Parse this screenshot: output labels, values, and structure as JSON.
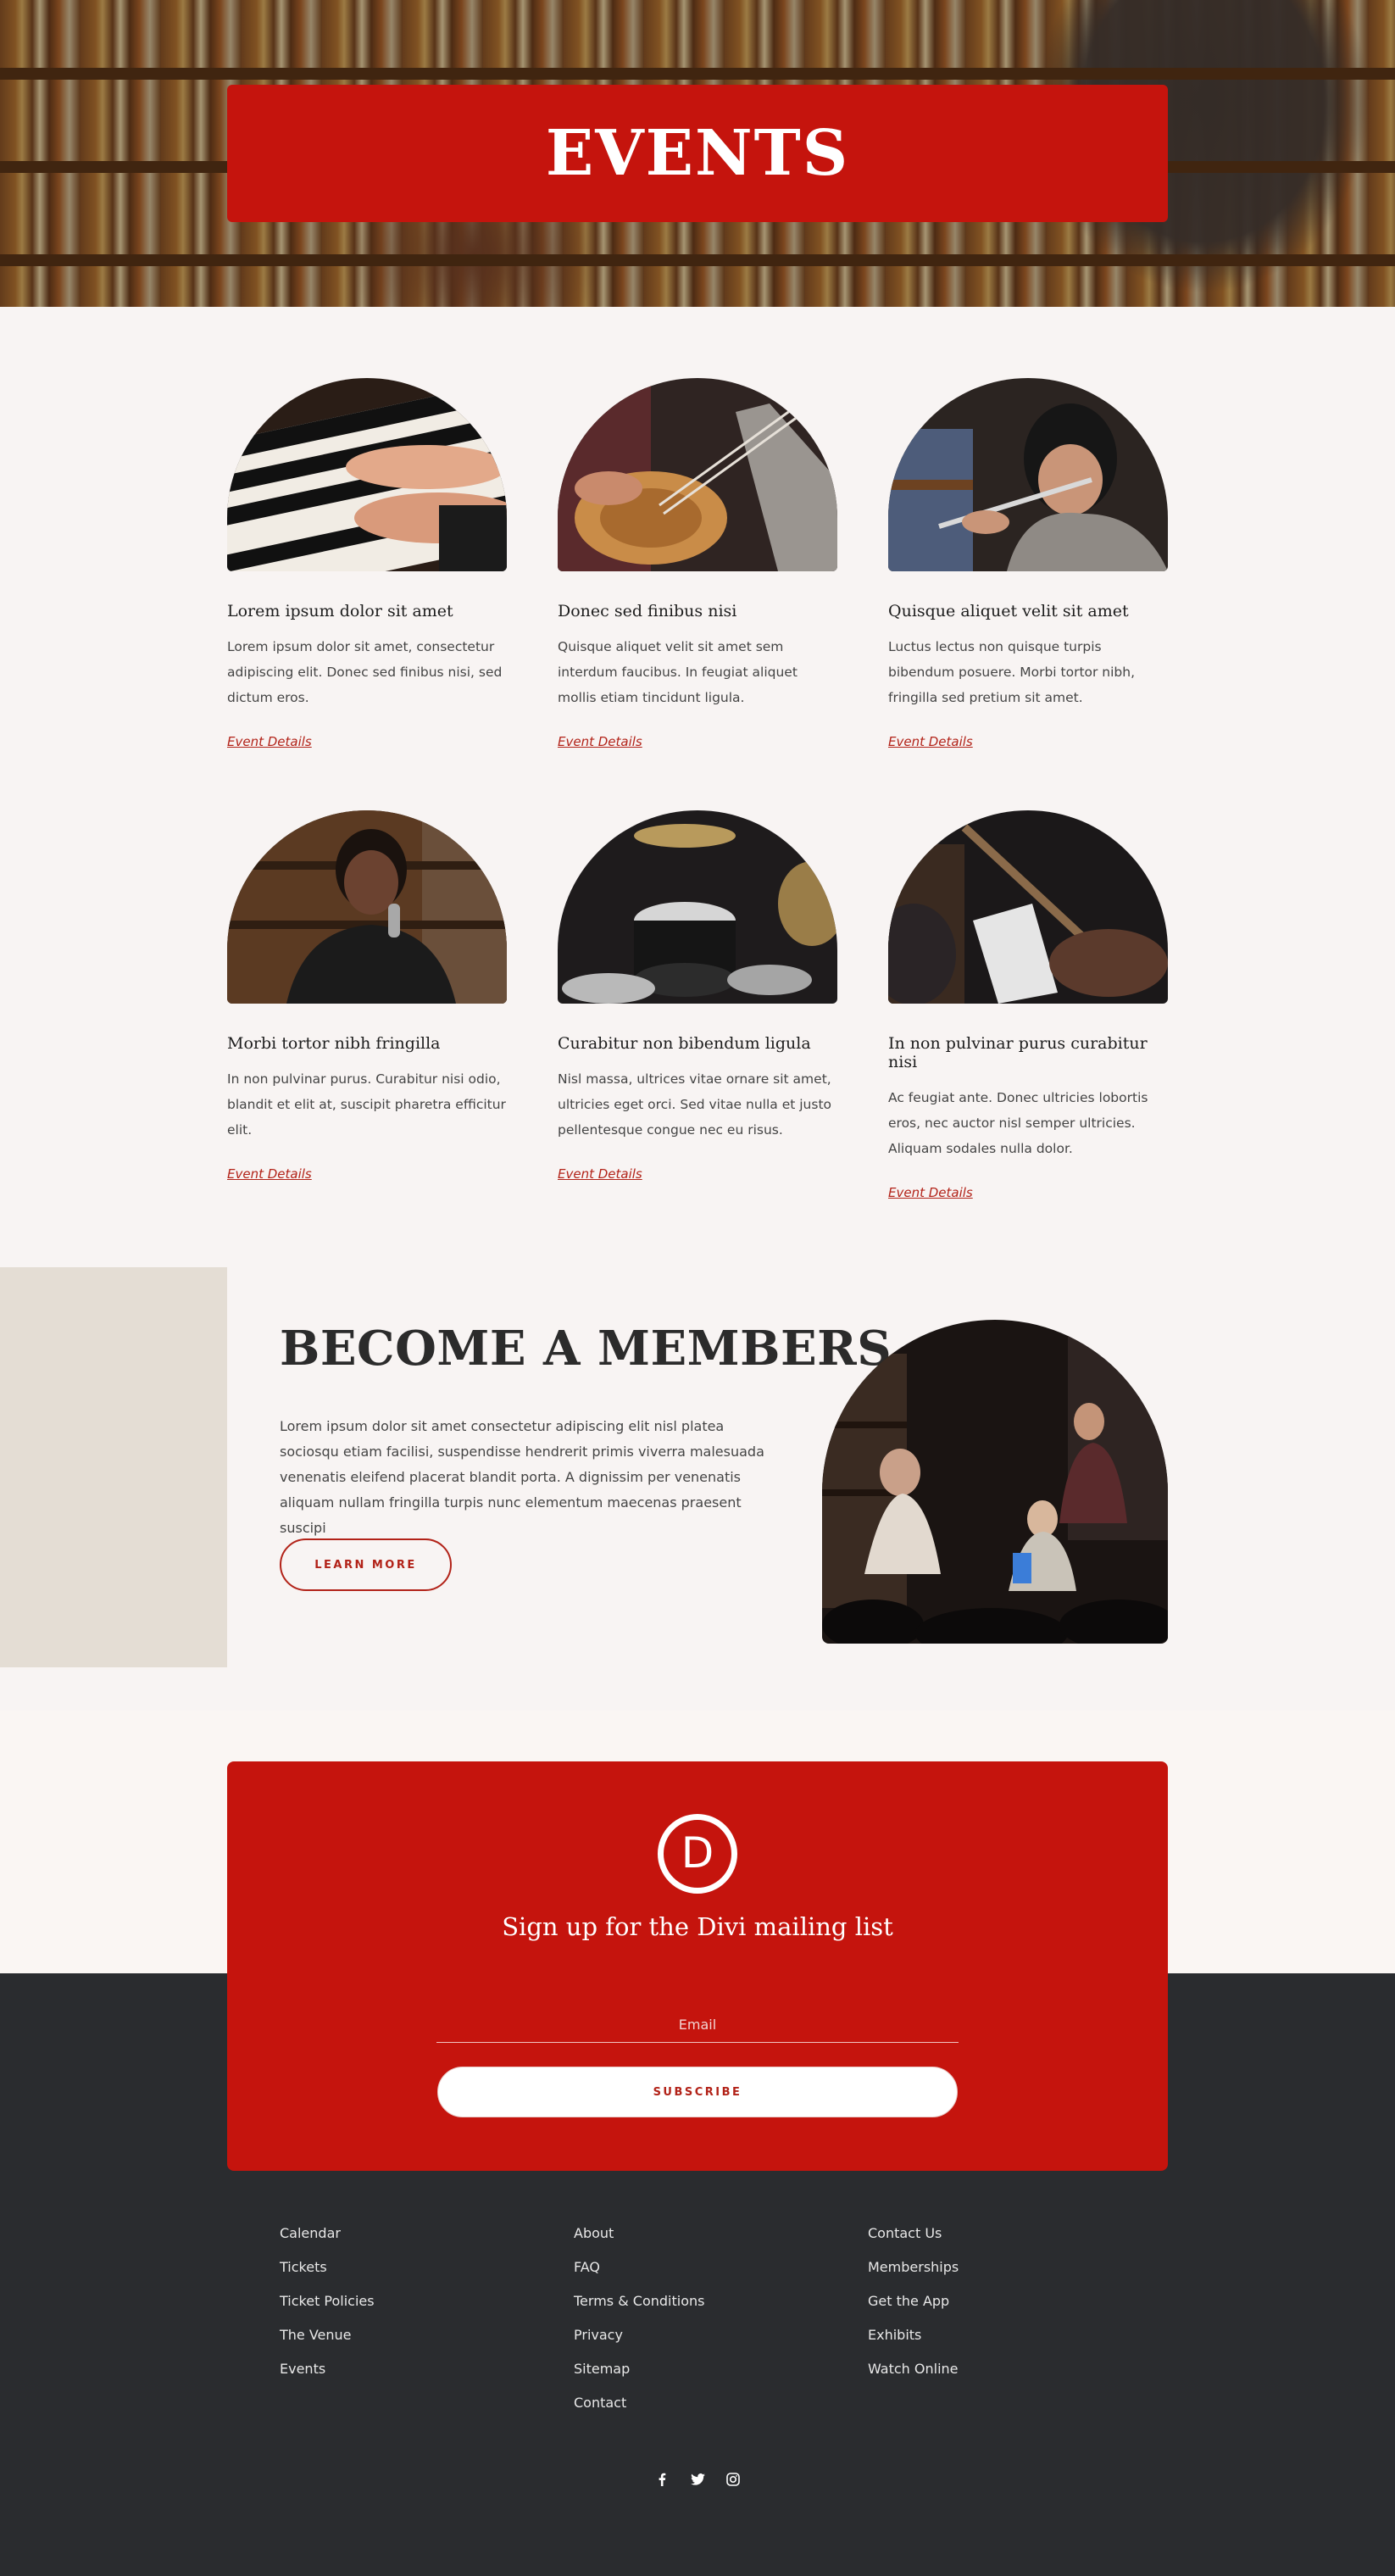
{
  "hero": {
    "title": "EVENTS"
  },
  "events": [
    {
      "title": "Lorem ipsum dolor sit amet",
      "desc": "Lorem ipsum dolor sit amet, consectetur adipiscing elit. Donec sed finibus nisi, sed dictum eros.",
      "link": "Event Details",
      "image": "piano-keys-photo"
    },
    {
      "title": "Donec sed finibus nisi",
      "desc": "Quisque aliquet velit sit amet sem interdum faucibus. In feugiat aliquet mollis etiam tincidunt ligula.",
      "link": "Event Details",
      "image": "bass-guitar-photo"
    },
    {
      "title": "Quisque aliquet velit sit amet",
      "desc": "Luctus lectus non quisque turpis bibendum posuere. Morbi tortor nibh, fringilla sed pretium sit amet.",
      "link": "Event Details",
      "image": "flute-player-photo"
    },
    {
      "title": "Morbi tortor nibh fringilla",
      "desc": "In non pulvinar purus. Curabitur nisi odio, blandit et elit at, suscipit pharetra efficitur elit.",
      "link": "Event Details",
      "image": "singer-photo"
    },
    {
      "title": "Curabitur non bibendum ligula",
      "desc": "Nisl massa, ultrices vitae ornare sit amet, ultricies eget orci. Sed vitae nulla et justo pellentesque congue nec eu risus.",
      "link": "Event Details",
      "image": "drum-kit-photo"
    },
    {
      "title": "In non pulvinar purus curabitur nisi",
      "desc": "Ac feugiat ante. Donec ultricies lobortis eros, nec auctor nisl semper ultricies. Aliquam sodales nulla dolor.",
      "link": "Event Details",
      "image": "guitar-sheet-music-photo"
    }
  ],
  "members": {
    "title": "BECOME A MEMBERS",
    "text": "Lorem ipsum dolor sit amet consectetur adipiscing elit nisl platea sociosqu etiam facilisi, suspendisse hendrerit primis viverra malesuada venenatis eleifend placerat blandit porta. A dignissim per venenatis aliquam nullam fringilla turpis nunc elementum maecenas praesent suscipi",
    "button": "LEARN MORE",
    "image": "band-performance-photo"
  },
  "newsletter": {
    "logo_letter": "D",
    "title": "Sign up for the Divi mailing list",
    "email_placeholder": "Email",
    "button": "SUBSCRIBE"
  },
  "footer": {
    "col1": [
      "Calendar",
      "Tickets",
      "Ticket Policies",
      "The Venue",
      "Events"
    ],
    "col2": [
      "About",
      "FAQ",
      "Terms & Conditions",
      "Privacy",
      "Sitemap",
      "Contact"
    ],
    "col3": [
      "Contact Us",
      "Memberships",
      "Get the App",
      "Exhibits",
      "Watch Online"
    ],
    "socials": [
      "facebook-icon",
      "twitter-icon",
      "instagram-icon"
    ]
  },
  "colors": {
    "brand_red": "#c5140d",
    "link_red": "#b22218",
    "footer_bg": "#2a2c2f",
    "page_bg": "#f8f4f3",
    "accent_beige": "#e4ddd4"
  }
}
